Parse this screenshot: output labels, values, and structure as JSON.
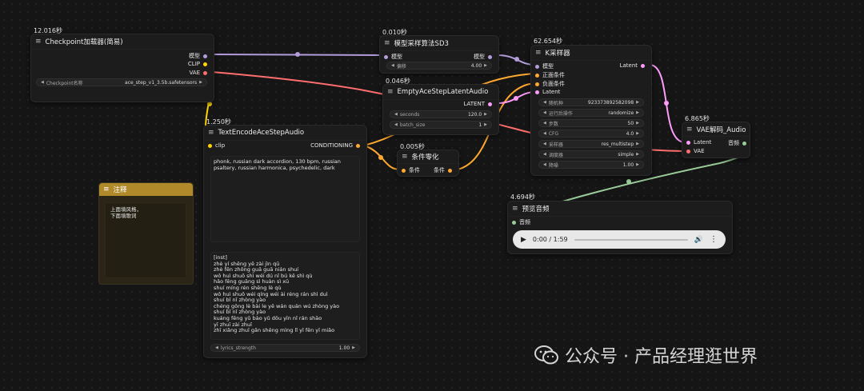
{
  "colors": {
    "model": "#b39ddb",
    "clip": "#ffd500",
    "vae": "#ff6e6e",
    "latent": "#ff9cf9",
    "conditioning": "#ffa931",
    "audio": "#9acd9a",
    "float": "#aaaaaa"
  },
  "checkpoint": {
    "timing": "12.016秒",
    "title": "Checkpoint加载器(简易)",
    "outputs": [
      "模型",
      "CLIP",
      "VAE"
    ],
    "widget_label": "Checkpoint名称",
    "widget_value": "ace_step_v1_3.5b.safetensors"
  },
  "sampling": {
    "timing": "0.010秒",
    "title": "模型采样算法SD3",
    "input": "模型",
    "output": "模型",
    "widget_label": "偏移",
    "widget_value": "4.00"
  },
  "latent": {
    "timing": "0.046秒",
    "title": "EmptyAceStepLatentAudio",
    "output": "LATENT",
    "w1_label": "seconds",
    "w1_value": "120.0",
    "w2_label": "batch_size",
    "w2_value": "1"
  },
  "ksampler": {
    "timing": "62.654秒",
    "title": "K采样器",
    "inputs": [
      "模型",
      "正面条件",
      "负面条件",
      "Latent"
    ],
    "output": "Latent",
    "widgets": [
      {
        "label": "随机种",
        "value": "923373892582098"
      },
      {
        "label": "运行后操作",
        "value": "randomize"
      },
      {
        "label": "步数",
        "value": "50"
      },
      {
        "label": "CFG",
        "value": "4.0"
      },
      {
        "label": "采样器",
        "value": "res_multistep"
      },
      {
        "label": "调度器",
        "value": "simple"
      },
      {
        "label": "降噪",
        "value": "1.00"
      }
    ]
  },
  "textenc": {
    "timing": "1.250秒",
    "title": "TextEncodeAceStepAudio",
    "input": "clip",
    "output": "CONDITIONING",
    "tags": "phonk, russian dark accordion, 130 bpm, russian psaltery, russian harmonica, psychedelic, dark",
    "lyrics": "[inst]\nzhè yí shēng yě zài jìn qū\nzhè fēn zhōng guā guā nián shuí\nwǒ huì shuō shì wéi dú nǐ bú kě shì qù\nhǎo fēng guāng sì huàn sì xū\nshuí míng rén shēng lè qù\nwǒ huì shuō wéi qíng wéi ài réng rán shì duì\nshuí bǐ nǐ zhòng yào\nchéng gōng lè bài le yě wán quán wú zhòng yào\nshuí bǐ nǐ zhòng yào\nkuáng fēng yǔ bào yǔ dōu yīn nǐ rán shāo\nyī zhuī zài zhuī\nzhī xiǎng zhuī gǎn shēng mìng lǐ yī fēn yī miǎo",
    "widget_label": "lyrics_strength",
    "widget_value": "1.00"
  },
  "zero": {
    "timing": "0.005秒",
    "title": "条件零化",
    "input": "条件",
    "output": "条件"
  },
  "vae": {
    "timing": "6.865秒",
    "title": "VAE解码_Audio",
    "inputs": [
      "Latent",
      "VAE"
    ],
    "output": "音频"
  },
  "preview": {
    "timing": "4.694秒",
    "title": "预览音频",
    "input": "音频",
    "time": "0:00 / 1:59"
  },
  "note": {
    "title": "注释",
    "text": "上面填风格，\n下面填歌词"
  },
  "watermark": "公众号 · 产品经理逛世界"
}
